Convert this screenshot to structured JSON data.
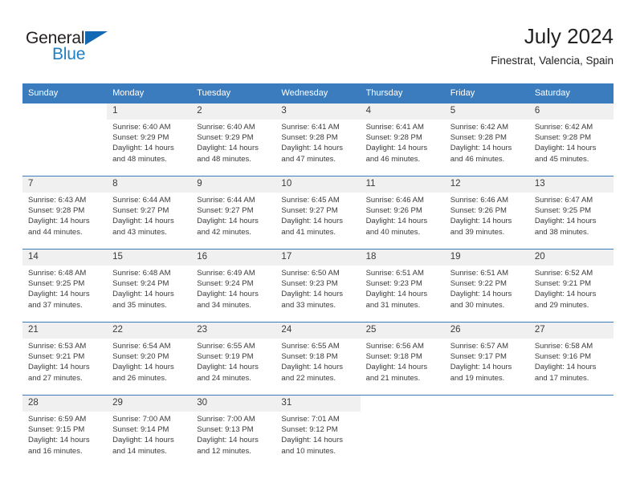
{
  "brand": {
    "word1": "General",
    "word2": "Blue",
    "triangle_color": "#1268b3",
    "word2_color": "#1f7fc4"
  },
  "header": {
    "title": "July 2024",
    "subtitle": "Finestrat, Valencia, Spain"
  },
  "theme": {
    "header_bg": "#3a7cbe",
    "daynum_bg": "#f0f0f0",
    "row_border": "#3a7cbe",
    "text": "#3a3a3a"
  },
  "weekdays": [
    "Sunday",
    "Monday",
    "Tuesday",
    "Wednesday",
    "Thursday",
    "Friday",
    "Saturday"
  ],
  "labels": {
    "sunrise_prefix": "Sunrise:",
    "sunset_prefix": "Sunset:",
    "daylight_prefix": "Daylight:"
  },
  "weeks": [
    [
      {
        "day": "",
        "blank": true,
        "l1": "",
        "l2": "",
        "l3": "",
        "l4": ""
      },
      {
        "day": "1",
        "l1": "Sunrise: 6:40 AM",
        "l2": "Sunset: 9:29 PM",
        "l3": "Daylight: 14 hours",
        "l4": "and 48 minutes."
      },
      {
        "day": "2",
        "l1": "Sunrise: 6:40 AM",
        "l2": "Sunset: 9:29 PM",
        "l3": "Daylight: 14 hours",
        "l4": "and 48 minutes."
      },
      {
        "day": "3",
        "l1": "Sunrise: 6:41 AM",
        "l2": "Sunset: 9:28 PM",
        "l3": "Daylight: 14 hours",
        "l4": "and 47 minutes."
      },
      {
        "day": "4",
        "l1": "Sunrise: 6:41 AM",
        "l2": "Sunset: 9:28 PM",
        "l3": "Daylight: 14 hours",
        "l4": "and 46 minutes."
      },
      {
        "day": "5",
        "l1": "Sunrise: 6:42 AM",
        "l2": "Sunset: 9:28 PM",
        "l3": "Daylight: 14 hours",
        "l4": "and 46 minutes."
      },
      {
        "day": "6",
        "l1": "Sunrise: 6:42 AM",
        "l2": "Sunset: 9:28 PM",
        "l3": "Daylight: 14 hours",
        "l4": "and 45 minutes."
      }
    ],
    [
      {
        "day": "7",
        "l1": "Sunrise: 6:43 AM",
        "l2": "Sunset: 9:28 PM",
        "l3": "Daylight: 14 hours",
        "l4": "and 44 minutes."
      },
      {
        "day": "8",
        "l1": "Sunrise: 6:44 AM",
        "l2": "Sunset: 9:27 PM",
        "l3": "Daylight: 14 hours",
        "l4": "and 43 minutes."
      },
      {
        "day": "9",
        "l1": "Sunrise: 6:44 AM",
        "l2": "Sunset: 9:27 PM",
        "l3": "Daylight: 14 hours",
        "l4": "and 42 minutes."
      },
      {
        "day": "10",
        "l1": "Sunrise: 6:45 AM",
        "l2": "Sunset: 9:27 PM",
        "l3": "Daylight: 14 hours",
        "l4": "and 41 minutes."
      },
      {
        "day": "11",
        "l1": "Sunrise: 6:46 AM",
        "l2": "Sunset: 9:26 PM",
        "l3": "Daylight: 14 hours",
        "l4": "and 40 minutes."
      },
      {
        "day": "12",
        "l1": "Sunrise: 6:46 AM",
        "l2": "Sunset: 9:26 PM",
        "l3": "Daylight: 14 hours",
        "l4": "and 39 minutes."
      },
      {
        "day": "13",
        "l1": "Sunrise: 6:47 AM",
        "l2": "Sunset: 9:25 PM",
        "l3": "Daylight: 14 hours",
        "l4": "and 38 minutes."
      }
    ],
    [
      {
        "day": "14",
        "l1": "Sunrise: 6:48 AM",
        "l2": "Sunset: 9:25 PM",
        "l3": "Daylight: 14 hours",
        "l4": "and 37 minutes."
      },
      {
        "day": "15",
        "l1": "Sunrise: 6:48 AM",
        "l2": "Sunset: 9:24 PM",
        "l3": "Daylight: 14 hours",
        "l4": "and 35 minutes."
      },
      {
        "day": "16",
        "l1": "Sunrise: 6:49 AM",
        "l2": "Sunset: 9:24 PM",
        "l3": "Daylight: 14 hours",
        "l4": "and 34 minutes."
      },
      {
        "day": "17",
        "l1": "Sunrise: 6:50 AM",
        "l2": "Sunset: 9:23 PM",
        "l3": "Daylight: 14 hours",
        "l4": "and 33 minutes."
      },
      {
        "day": "18",
        "l1": "Sunrise: 6:51 AM",
        "l2": "Sunset: 9:23 PM",
        "l3": "Daylight: 14 hours",
        "l4": "and 31 minutes."
      },
      {
        "day": "19",
        "l1": "Sunrise: 6:51 AM",
        "l2": "Sunset: 9:22 PM",
        "l3": "Daylight: 14 hours",
        "l4": "and 30 minutes."
      },
      {
        "day": "20",
        "l1": "Sunrise: 6:52 AM",
        "l2": "Sunset: 9:21 PM",
        "l3": "Daylight: 14 hours",
        "l4": "and 29 minutes."
      }
    ],
    [
      {
        "day": "21",
        "l1": "Sunrise: 6:53 AM",
        "l2": "Sunset: 9:21 PM",
        "l3": "Daylight: 14 hours",
        "l4": "and 27 minutes."
      },
      {
        "day": "22",
        "l1": "Sunrise: 6:54 AM",
        "l2": "Sunset: 9:20 PM",
        "l3": "Daylight: 14 hours",
        "l4": "and 26 minutes."
      },
      {
        "day": "23",
        "l1": "Sunrise: 6:55 AM",
        "l2": "Sunset: 9:19 PM",
        "l3": "Daylight: 14 hours",
        "l4": "and 24 minutes."
      },
      {
        "day": "24",
        "l1": "Sunrise: 6:55 AM",
        "l2": "Sunset: 9:18 PM",
        "l3": "Daylight: 14 hours",
        "l4": "and 22 minutes."
      },
      {
        "day": "25",
        "l1": "Sunrise: 6:56 AM",
        "l2": "Sunset: 9:18 PM",
        "l3": "Daylight: 14 hours",
        "l4": "and 21 minutes."
      },
      {
        "day": "26",
        "l1": "Sunrise: 6:57 AM",
        "l2": "Sunset: 9:17 PM",
        "l3": "Daylight: 14 hours",
        "l4": "and 19 minutes."
      },
      {
        "day": "27",
        "l1": "Sunrise: 6:58 AM",
        "l2": "Sunset: 9:16 PM",
        "l3": "Daylight: 14 hours",
        "l4": "and 17 minutes."
      }
    ],
    [
      {
        "day": "28",
        "l1": "Sunrise: 6:59 AM",
        "l2": "Sunset: 9:15 PM",
        "l3": "Daylight: 14 hours",
        "l4": "and 16 minutes."
      },
      {
        "day": "29",
        "l1": "Sunrise: 7:00 AM",
        "l2": "Sunset: 9:14 PM",
        "l3": "Daylight: 14 hours",
        "l4": "and 14 minutes."
      },
      {
        "day": "30",
        "l1": "Sunrise: 7:00 AM",
        "l2": "Sunset: 9:13 PM",
        "l3": "Daylight: 14 hours",
        "l4": "and 12 minutes."
      },
      {
        "day": "31",
        "l1": "Sunrise: 7:01 AM",
        "l2": "Sunset: 9:12 PM",
        "l3": "Daylight: 14 hours",
        "l4": "and 10 minutes."
      },
      {
        "day": "",
        "blank": true,
        "l1": "",
        "l2": "",
        "l3": "",
        "l4": ""
      },
      {
        "day": "",
        "blank": true,
        "l1": "",
        "l2": "",
        "l3": "",
        "l4": ""
      },
      {
        "day": "",
        "blank": true,
        "l1": "",
        "l2": "",
        "l3": "",
        "l4": ""
      }
    ]
  ]
}
